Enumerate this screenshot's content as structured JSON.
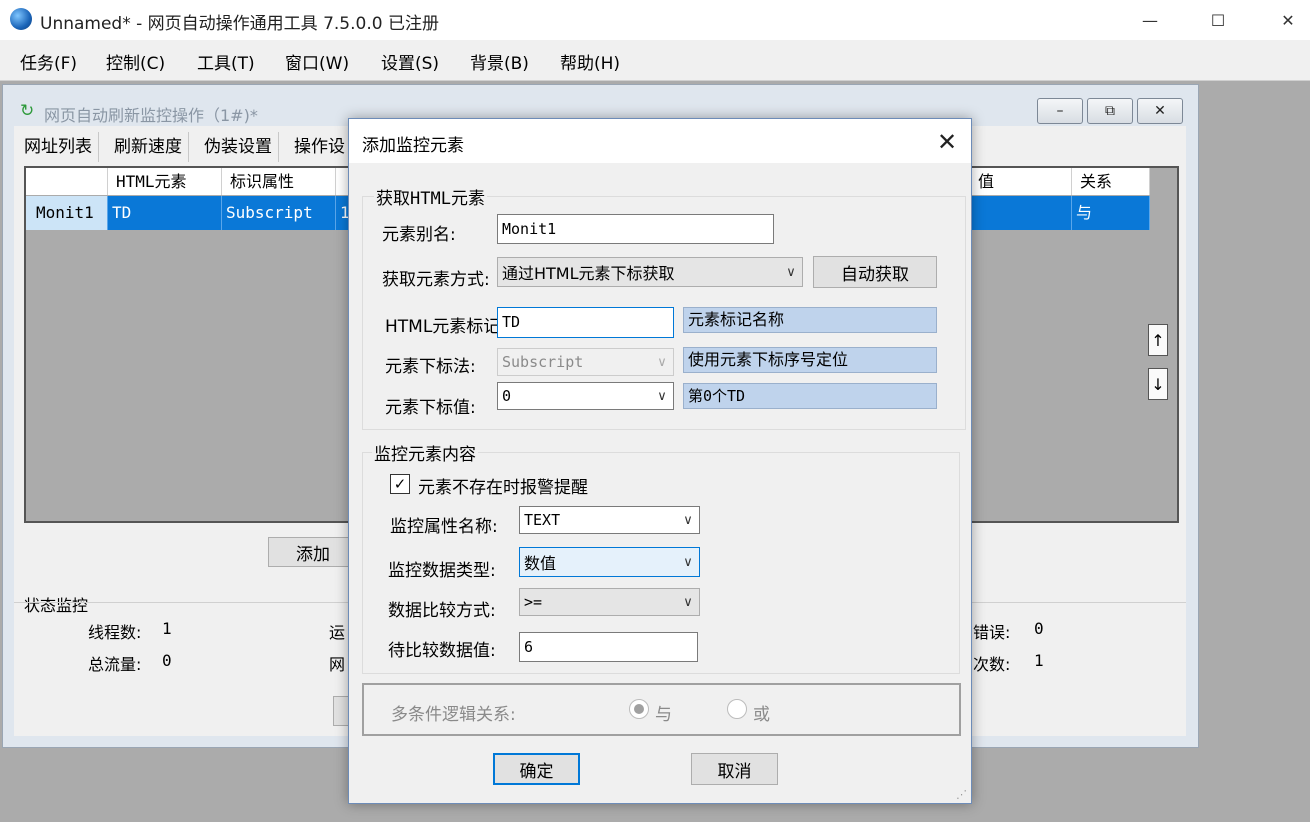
{
  "window": {
    "title": "Unnamed* - 网页自动操作通用工具 7.5.0.0  已注册",
    "minimize_glyph": "—",
    "maximize_glyph": "☐",
    "close_glyph": "✕"
  },
  "menu": [
    "任务(F)",
    "控制(C)",
    "工具(T)",
    "窗口(W)",
    "设置(S)",
    "背景(B)",
    "帮助(H)"
  ],
  "child": {
    "title": "网页自动刷新监控操作（1#)*",
    "tabs": [
      "网址列表",
      "刷新速度",
      "伪装设置",
      "操作设"
    ],
    "columns": [
      "",
      "HTML元素",
      "标识属性",
      "",
      "值",
      "关系"
    ],
    "rows": [
      {
        "name": "Monit1",
        "element": "TD",
        "attr": "Subscript",
        "c3": "1",
        "value": "",
        "relation": "与"
      }
    ],
    "add_label": "添加",
    "up_glyph": "↑",
    "down_glyph": "↓",
    "status": {
      "group_title": "状态监控",
      "threads_label": "线程数:",
      "threads_value": "1",
      "traffic_label": "总流量:",
      "traffic_value": "0",
      "run_label": "运",
      "web_label": "网",
      "errors_label": "错误:",
      "errors_value": "0",
      "count_label": "次数:",
      "count_value": "1"
    }
  },
  "dialog": {
    "title": "添加监控元素",
    "group1_title": "获取HTML元素",
    "alias_label": "元素别名:",
    "alias_value": "Monit1",
    "method_label": "获取元素方式:",
    "method_value": "通过HTML元素下标获取",
    "auto_button": "自动获取",
    "tag_label": "HTML元素标记:",
    "tag_value": "TD",
    "tag_info": "元素标记名称",
    "index_method_label": "元素下标法:",
    "index_method_value": "Subscript",
    "index_method_info": "使用元素下标序号定位",
    "index_value_label": "元素下标值:",
    "index_value": "0",
    "index_value_info": "第0个TD",
    "group2_title": "监控元素内容",
    "alarm_checkbox_label": "元素不存在时报警提醒",
    "alarm_checked": true,
    "attr_label": "监控属性名称:",
    "attr_value": "TEXT",
    "type_label": "监控数据类型:",
    "type_value": "数值",
    "compare_label": "数据比较方式:",
    "compare_value": ">=",
    "target_label": "待比较数据值:",
    "target_value": "6",
    "logic_label": "多条件逻辑关系:",
    "logic_and": "与",
    "logic_or": "或",
    "logic_selected": "与",
    "ok_button": "确定",
    "cancel_button": "取消"
  }
}
